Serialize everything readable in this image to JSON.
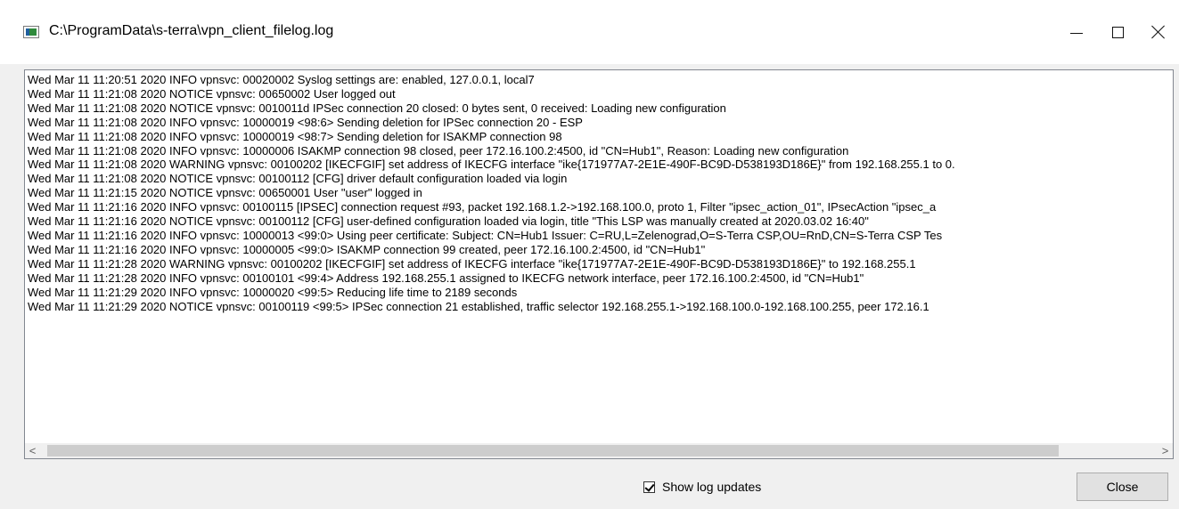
{
  "window": {
    "title": "C:\\ProgramData\\s-terra\\vpn_client_filelog.log",
    "icon": "log-viewer-app-icon"
  },
  "caption_buttons": {
    "minimize_icon": "minimize-icon",
    "maximize_icon": "maximize-icon",
    "close_icon": "close-icon"
  },
  "log": {
    "lines": [
      "Wed Mar 11 11:20:51 2020 INFO vpnsvc: 00020002 Syslog settings are: enabled, 127.0.0.1, local7",
      "Wed Mar 11 11:21:08 2020 NOTICE vpnsvc: 00650002 User logged out",
      "Wed Mar 11 11:21:08 2020 NOTICE vpnsvc: 0010011d IPSec connection 20 closed: 0 bytes sent, 0 received: Loading new configuration",
      "Wed Mar 11 11:21:08 2020 INFO vpnsvc: 10000019 <98:6> Sending deletion for IPSec connection 20 - ESP",
      "Wed Mar 11 11:21:08 2020 INFO vpnsvc: 10000019 <98:7> Sending deletion for ISAKMP connection 98",
      "Wed Mar 11 11:21:08 2020 INFO vpnsvc: 10000006 ISAKMP connection 98 closed, peer 172.16.100.2:4500, id \"CN=Hub1\", Reason: Loading new configuration",
      "Wed Mar 11 11:21:08 2020 WARNING vpnsvc: 00100202 [IKECFGIF] set address of IKECFG interface \"ike{171977A7-2E1E-490F-BC9D-D538193D186E}\" from 192.168.255.1 to 0.",
      "Wed Mar 11 11:21:08 2020 NOTICE vpnsvc: 00100112 [CFG] driver default configuration loaded via login",
      "Wed Mar 11 11:21:15 2020 NOTICE vpnsvc: 00650001 User \"user\" logged in",
      "Wed Mar 11 11:21:16 2020 INFO vpnsvc: 00100115 [IPSEC] connection request #93, packet 192.168.1.2->192.168.100.0, proto 1, Filter \"ipsec_action_01\", IPsecAction \"ipsec_a",
      "Wed Mar 11 11:21:16 2020 NOTICE vpnsvc: 00100112 [CFG] user-defined configuration loaded via login, title \"This LSP was manually created at 2020.03.02 16:40\"",
      "Wed Mar 11 11:21:16 2020 INFO vpnsvc: 10000013 <99:0> Using peer certificate: Subject: CN=Hub1 Issuer: C=RU,L=Zelenograd,O=S-Terra CSP,OU=RnD,CN=S-Terra CSP Tes",
      "Wed Mar 11 11:21:16 2020 INFO vpnsvc: 10000005 <99:0> ISAKMP connection 99 created, peer 172.16.100.2:4500, id \"CN=Hub1\"",
      "Wed Mar 11 11:21:28 2020 WARNING vpnsvc: 00100202 [IKECFGIF] set address of IKECFG interface \"ike{171977A7-2E1E-490F-BC9D-D538193D186E}\" to 192.168.255.1",
      "Wed Mar 11 11:21:28 2020 INFO vpnsvc: 00100101 <99:4> Address 192.168.255.1 assigned to IKECFG network interface, peer 172.16.100.2:4500, id \"CN=Hub1\"",
      "Wed Mar 11 11:21:29 2020 INFO vpnsvc: 10000020 <99:5> Reducing life time to 2189 seconds",
      "Wed Mar 11 11:21:29 2020 NOTICE vpnsvc: 00100119 <99:5> IPSec connection 21 established, traffic selector 192.168.255.1->192.168.100.0-192.168.100.255, peer 172.16.1"
    ]
  },
  "scrollbar": {
    "left_arrow": "<",
    "right_arrow": ">"
  },
  "footer": {
    "show_updates_label": "Show log updates",
    "show_updates_checked": true,
    "close_label": "Close"
  }
}
